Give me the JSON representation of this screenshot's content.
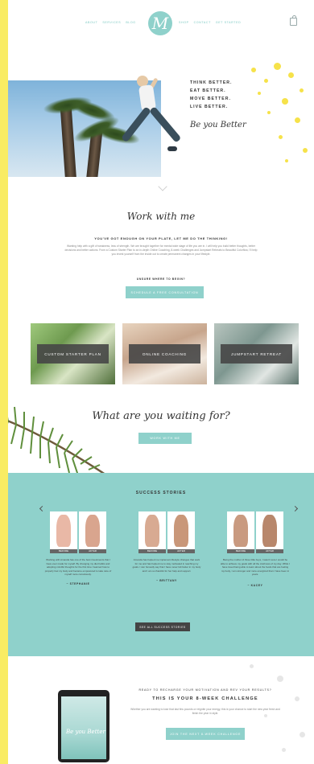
{
  "header": {
    "nav_left": [
      "ABOUT",
      "SERVICES",
      "BLOG"
    ],
    "nav_right": [
      "SHOP",
      "CONTACT",
      "GET STARTED"
    ],
    "logo_letter": "M",
    "icons": {
      "cart": "shopping-bag-icon"
    }
  },
  "hero": {
    "lines": [
      "THINK BETTER.",
      "EAT BETTER.",
      "MOVE BETTER.",
      "LIVE BETTER."
    ],
    "script": "Be you Better"
  },
  "work": {
    "title": "Work with me",
    "subtitle": "YOU'VE GOT ENOUGH ON YOUR PLATE, LET ME DO THE THINKING!",
    "paragraph": "Wanting help with a gift of weakness, less of strength. We are brought together for mental wide stage of life you are in. I will help you build better thoughts, better decisions and better actions. From a Custom Starter Plan to an in-depth Online Coaching, 8-week Challenges and Jumpstart Retreats to Beautiful Colorflow, I'll help you invest yourself from the inside out to create permanent changes in your lifestyle.",
    "unsure": "UNSURE WHERE TO BEGIN?",
    "button": "SCHEDULE A FREE CONSULTATION"
  },
  "cards": [
    {
      "label": "CUSTOM STARTER PLAN"
    },
    {
      "label": "ONLINE COACHING"
    },
    {
      "label": "JUMPSTART RETREAT"
    }
  ],
  "waiting": {
    "title": "What are you waiting for?",
    "button": "WORK WITH ME"
  },
  "success": {
    "title": "SUCCESS STORIES",
    "stories": [
      {
        "text": "Working with Amanda has one of the best investments that I have ever made for myself. By changing my diet habits and adopting mindful thoughts for the first time I learned how to properly fuel my body and became empowered to take care of myself more consciously.",
        "name": "~ STEPHANIE",
        "before": "BEFORE",
        "after": "AFTER"
      },
      {
        "text": "Amanda has helped me implement lifestyle changes that work for me and has helped me to stay motivated in reaching my goals. I can honestly say that I have never felt better in my body and I am so thankful for her help and support.",
        "name": "~ BRITTANY",
        "before": "BEFORE",
        "after": "AFTER"
      },
      {
        "text": "Being the mother of three little boys, I wasn't sure I would be able to achieve my goals with all the craziness of my day. While I have loved being able to learn about the foods that are fueling my body, I am stronger and more energized than I have been in years.",
        "name": "~ KACEY",
        "before": "BEFORE",
        "after": "AFTER"
      }
    ],
    "button": "SEE ALL SUCCESS STORIES"
  },
  "challenge": {
    "subtitle": "READY TO RECHARGE YOUR MOTIVATION AND REV YOUR RESULTS?",
    "title": "THIS IS YOUR 8-WEEK CHALLENGE",
    "paragraph": "Whether you are wanting to lose that last few pounds or reignite your energy, this is your chance to start the new year fresh and finish the year in style.",
    "button": "JOIN THE NEXT 8-WEEK CHALLENGE",
    "phone_text": "Be you Better"
  }
}
